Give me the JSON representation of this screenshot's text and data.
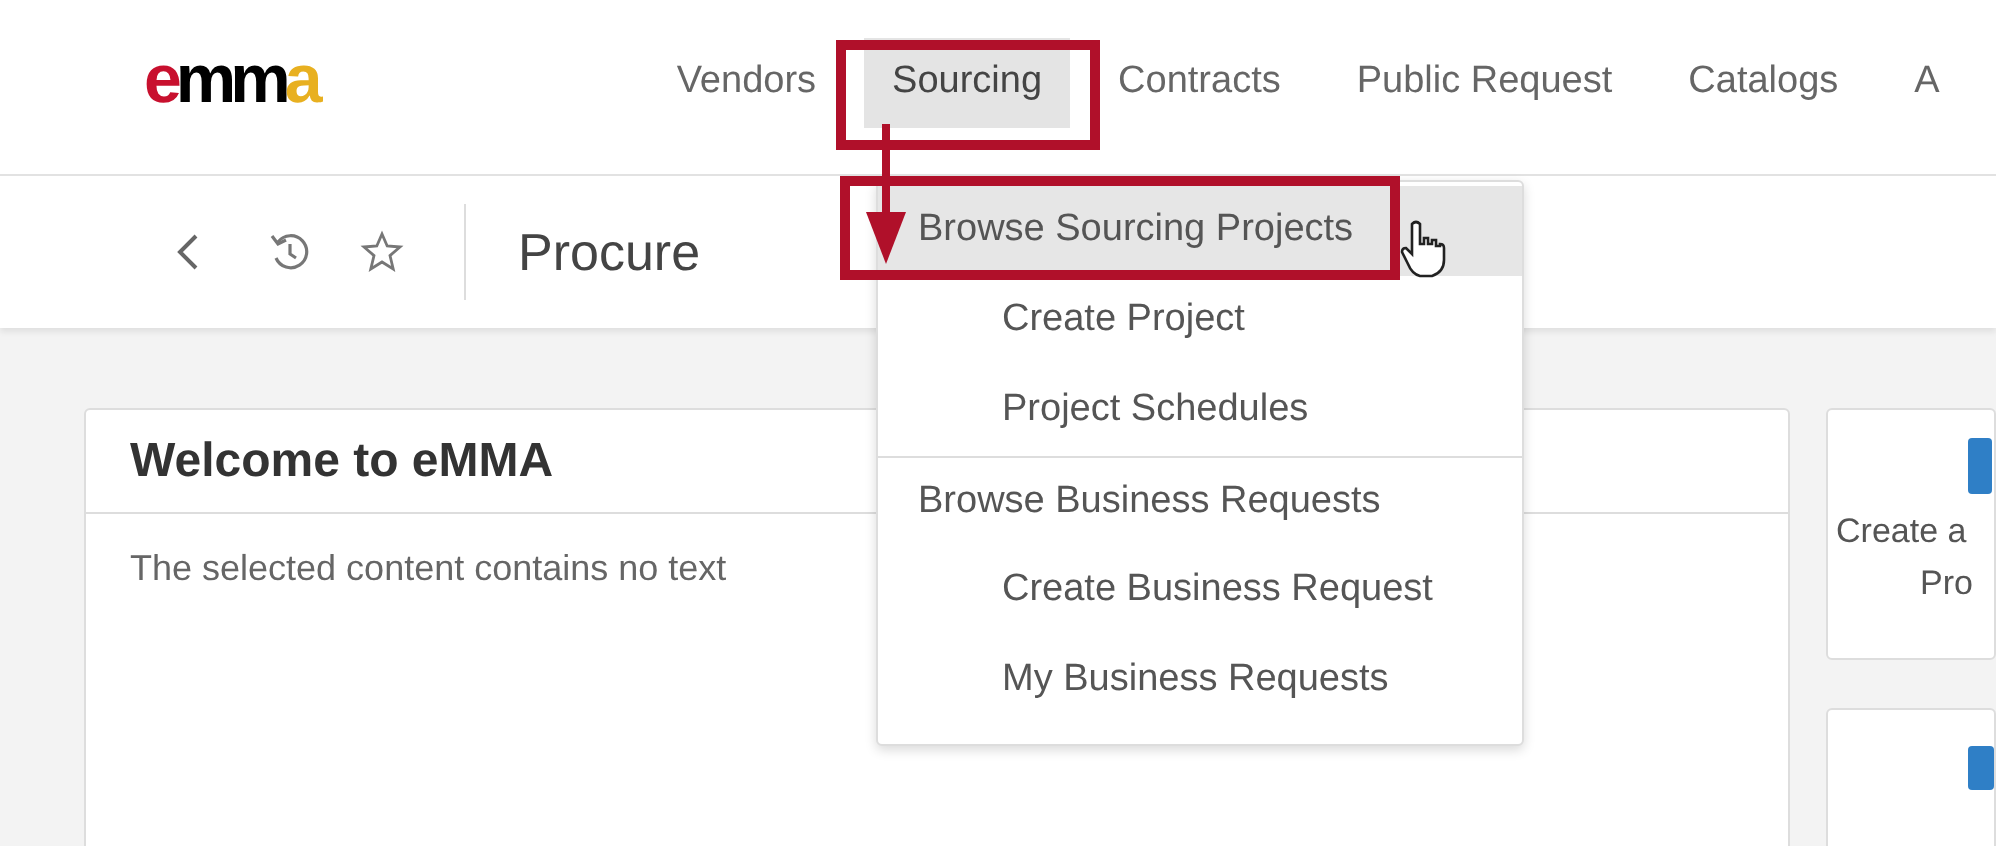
{
  "logo": {
    "text": "emma"
  },
  "nav": [
    {
      "label": "Vendors",
      "selected": false
    },
    {
      "label": "Sourcing",
      "selected": true
    },
    {
      "label": "Contracts",
      "selected": false
    },
    {
      "label": "Public Request",
      "selected": false
    },
    {
      "label": "Catalogs",
      "selected": false
    },
    {
      "label": "A",
      "selected": false
    }
  ],
  "page_title": "Procure",
  "dropdown": [
    {
      "label": "Browse Sourcing Projects",
      "selected": true,
      "children": [
        {
          "label": "Create Project",
          "selected": false
        },
        {
          "label": "Project Schedules",
          "selected": false
        }
      ]
    },
    {
      "label": "Browse Business Requests",
      "selected": false,
      "children": [
        {
          "label": "Create Business Request",
          "selected": false
        },
        {
          "label": "My Business Requests",
          "selected": false
        }
      ]
    }
  ],
  "welcome_card": {
    "title": "Welcome to eMMA",
    "body": "The selected content contains no text"
  },
  "side_cards": [
    {
      "lines": [
        "Create a",
        "Pro"
      ]
    }
  ]
}
